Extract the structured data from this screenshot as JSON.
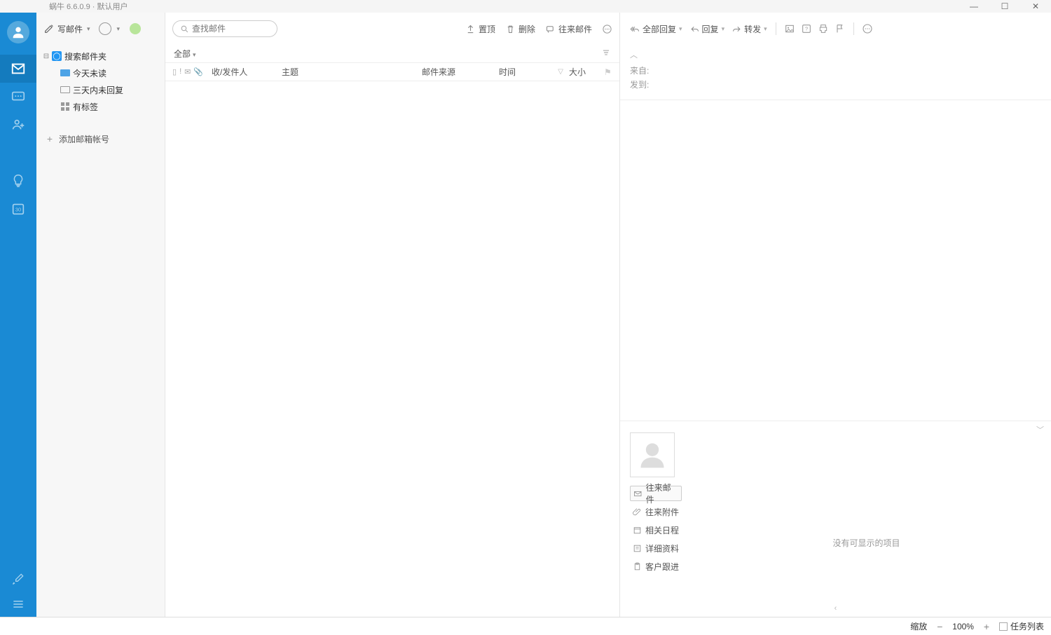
{
  "title": {
    "app": "蜗牛 6.6.0.9",
    "sep": " · ",
    "user": "默认用户"
  },
  "folderPane": {
    "composeLabel": "写邮件",
    "searchFolderRoot": "搜索邮件夹",
    "items": [
      {
        "label": "今天未读"
      },
      {
        "label": "三天内未回复"
      },
      {
        "label": "有标签"
      }
    ],
    "addAccount": "添加邮箱帐号"
  },
  "listPane": {
    "searchPlaceholder": "查找邮件",
    "toolbar": {
      "pinTop": "置顶",
      "del": "删除",
      "conversation": "往来邮件"
    },
    "filterAll": "全部",
    "headers": {
      "sender": "收/发件人",
      "subject": "主题",
      "source": "邮件来源",
      "time": "时间",
      "size": "大小"
    }
  },
  "previewPane": {
    "toolbar": {
      "replyAll": "全部回复",
      "reply": "回复",
      "forward": "转发"
    },
    "from": "来自:",
    "to": "发到:"
  },
  "contactPanel": {
    "tabs": [
      {
        "label": "往来邮件"
      },
      {
        "label": "往来附件"
      },
      {
        "label": "相关日程"
      },
      {
        "label": "详细资料"
      },
      {
        "label": "客户跟进"
      }
    ],
    "emptyText": "没有可显示的项目"
  },
  "statusbar": {
    "zoomLabel": "缩放",
    "zoomValue": "100%",
    "taskList": "任务列表"
  }
}
